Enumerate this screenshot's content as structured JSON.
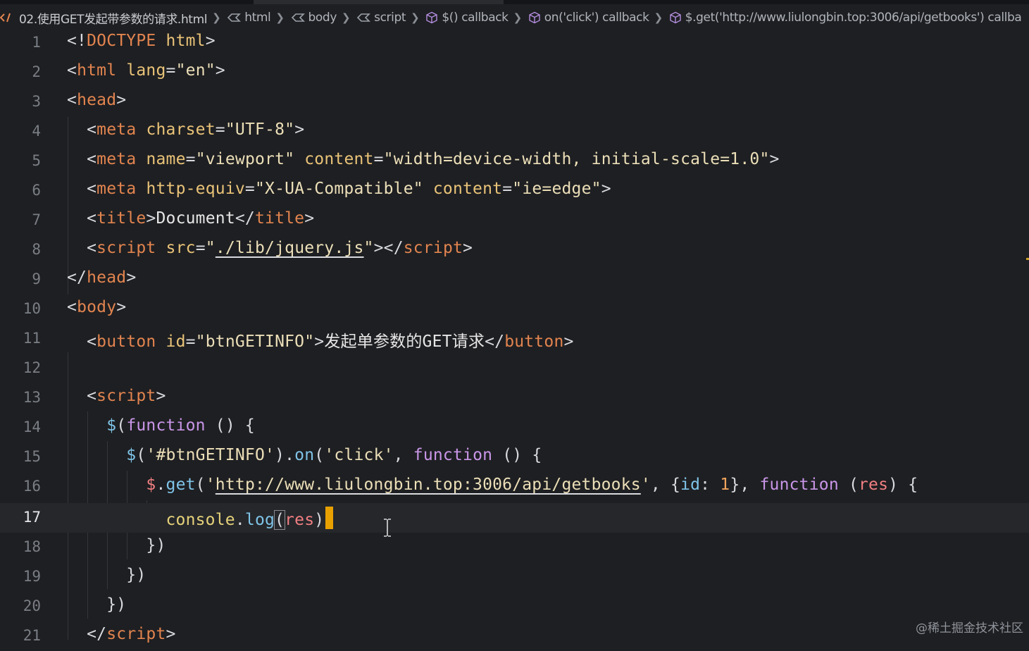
{
  "breadcrumb": {
    "file": "02.使用GET发起带参数的请求.html",
    "items": [
      "html",
      "body",
      "script",
      "$() callback",
      "on('click') callback",
      "$.get('http://www.liulongbin.top:3006/api/getbooks') callba"
    ]
  },
  "editor": {
    "current_line": 17,
    "lines": [
      {
        "n": "1"
      },
      {
        "n": "2"
      },
      {
        "n": "3"
      },
      {
        "n": "4"
      },
      {
        "n": "5"
      },
      {
        "n": "6"
      },
      {
        "n": "7"
      },
      {
        "n": "8"
      },
      {
        "n": "9"
      },
      {
        "n": "10"
      },
      {
        "n": "11"
      },
      {
        "n": "12"
      },
      {
        "n": "13"
      },
      {
        "n": "14"
      },
      {
        "n": "15"
      },
      {
        "n": "16"
      },
      {
        "n": "17"
      },
      {
        "n": "18"
      },
      {
        "n": "19"
      },
      {
        "n": "20"
      },
      {
        "n": "21"
      }
    ],
    "code": {
      "doctype": "DOCTYPE",
      "html_tag": "html",
      "lang_attr": "lang",
      "lang_val": "\"en\"",
      "head": "head",
      "meta": "meta",
      "charset_attr": "charset",
      "charset_val": "\"UTF-8\"",
      "name_attr": "name",
      "name_val": "\"viewport\"",
      "content_attr": "content",
      "viewport_content": "\"width=device-width, initial-scale=1.0\"",
      "http_equiv_attr": "http-equiv",
      "http_equiv_val": "\"X-UA-Compatible\"",
      "ie_edge": "\"ie=edge\"",
      "title_tag": "title",
      "title_text": "Document",
      "script_tag": "script",
      "src_attr": "src",
      "src_val": "./lib/jquery.js",
      "body": "body",
      "button_tag": "button",
      "id_attr": "id",
      "id_val": "\"btnGETINFO\"",
      "button_text": "发起单参数的GET请求",
      "function_kw": "function",
      "selector": "'#btnGETINFO'",
      "on_fn": "on",
      "click_str": "'click'",
      "get_fn": "get",
      "url": "http://www.liulongbin.top:3006/api/getbooks",
      "id_key": "id",
      "id_num": "1",
      "res": "res",
      "console": "console",
      "log_fn": "log"
    }
  },
  "watermark": "@稀土掘金技术社区"
}
